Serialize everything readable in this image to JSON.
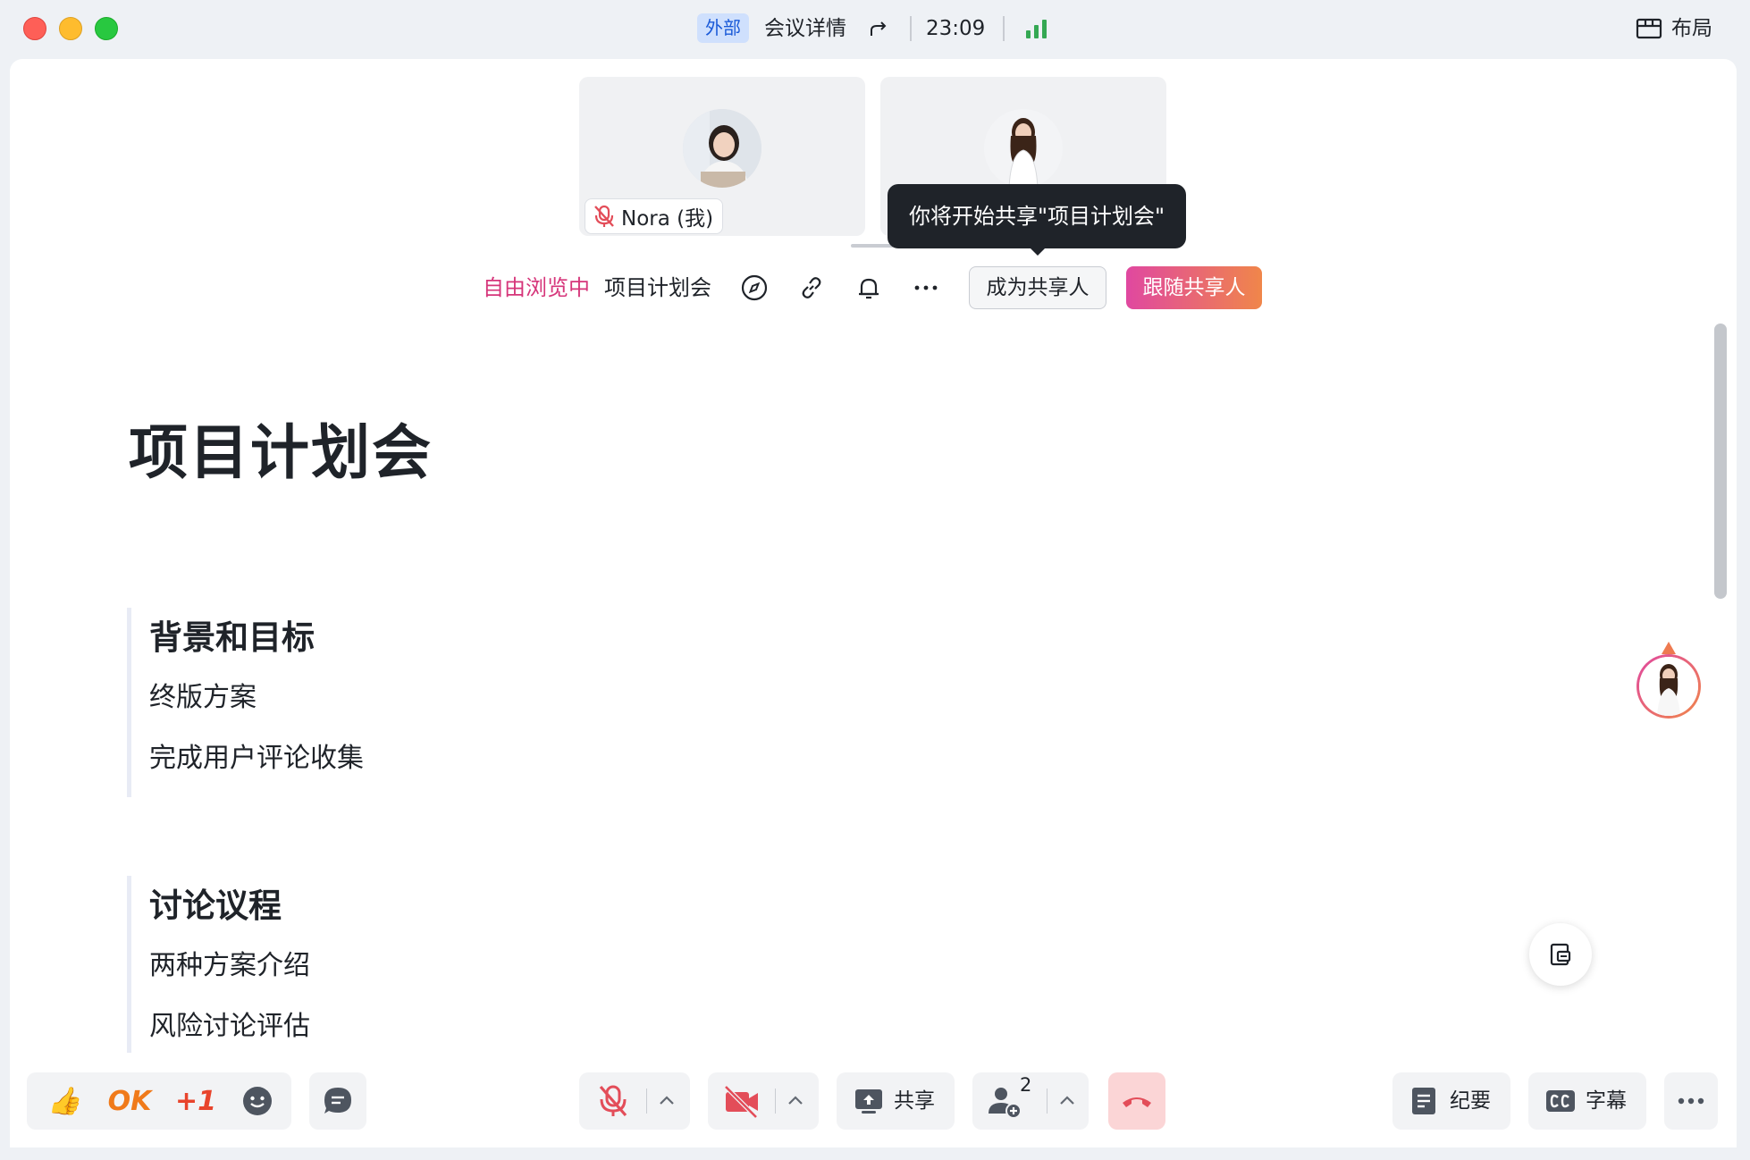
{
  "titlebar": {
    "external_badge": "外部",
    "meeting_details": "会议详情",
    "timer": "23:09",
    "layout_label": "布局"
  },
  "participants": [
    {
      "name": "Nora (我)",
      "muted": true
    },
    {
      "name": "",
      "muted": false
    }
  ],
  "tooltip": {
    "text": "你将开始共享\"项目计划会\""
  },
  "share_toolbar": {
    "status": "自由浏览中",
    "doc_name": "项目计划会",
    "become_presenter": "成为共享人",
    "follow_presenter": "跟随共享人"
  },
  "document": {
    "title": "项目计划会",
    "sections": [
      {
        "heading": "背景和目标",
        "items": [
          "终版方案",
          "完成用户评论收集"
        ]
      },
      {
        "heading": "讨论议程",
        "items": [
          "两种方案介绍",
          "风险讨论评估"
        ]
      }
    ]
  },
  "bottom_bar": {
    "reactions": [
      "👍",
      "OK",
      "+1"
    ],
    "share_label": "共享",
    "participant_count": "2",
    "minutes_label": "纪要",
    "captions_label": "字幕"
  },
  "colors": {
    "accent_pink": "#d6357a",
    "follow_gradient_start": "#e048a0",
    "follow_gradient_end": "#f0864a",
    "mute_red": "#e34d59",
    "signal_green": "#34a853"
  }
}
